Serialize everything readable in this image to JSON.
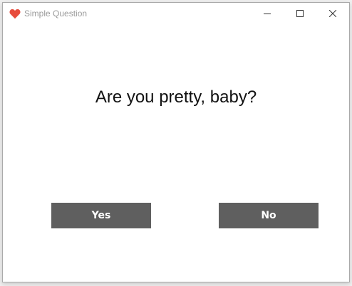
{
  "window": {
    "title": "Simple Question",
    "icon": "heart-icon",
    "icon_color": "#e74c3c",
    "controls": [
      "minimize-icon",
      "maximize-icon",
      "close-icon"
    ]
  },
  "content": {
    "question": "Are you pretty, baby?"
  },
  "buttons": {
    "yes_label": "Yes",
    "no_label": "No",
    "background_color": "#5f5f5f",
    "text_color": "#ffffff"
  }
}
